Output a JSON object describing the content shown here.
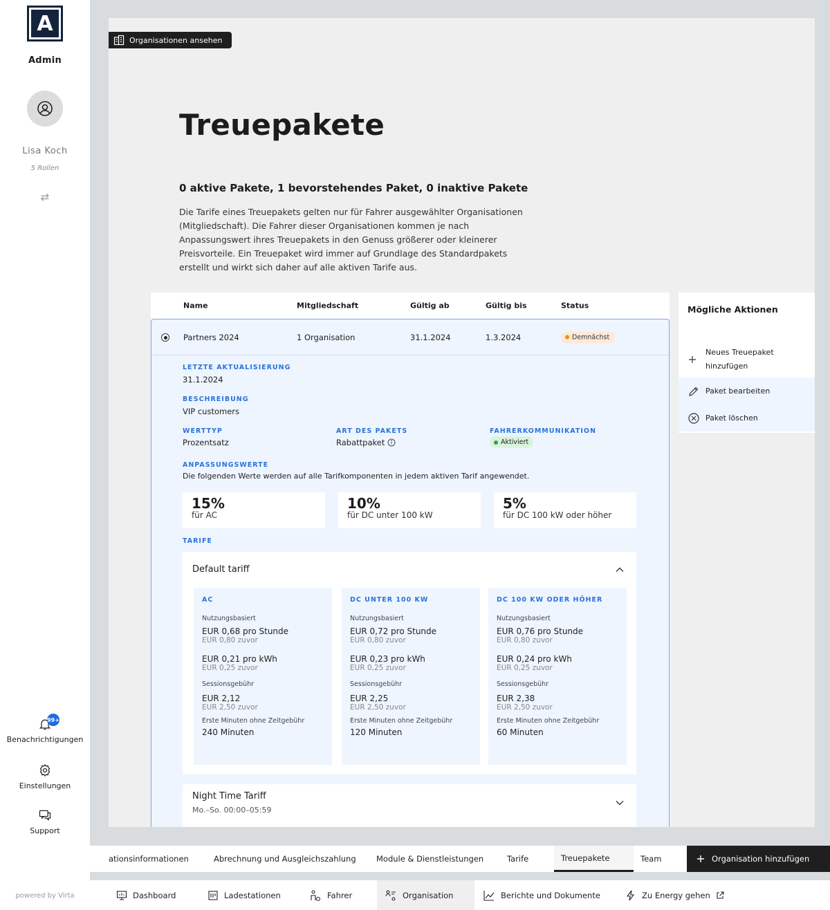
{
  "sidebar": {
    "logo_letter": "A",
    "role": "Admin",
    "user_name": "Lisa Koch",
    "user_roles": "5 Rollen",
    "notifications_badge": "99+",
    "notifications_label": "Benachrichtigungen",
    "settings_label": "Einstellungen",
    "support_label": "Support",
    "powered_by": "powered by Virta"
  },
  "header": {
    "view_orgs_button": "Organisationen ansehen",
    "page_title": "Treuepakete",
    "summary": "0 aktive Pakete, 1 bevorstehendes Paket, 0 inaktive Pakete",
    "description": "Die Tarife eines Treuepakets gelten nur für Fahrer ausgewählter Organisationen (Mitgliedschaft). Die Fahrer dieser Organisationen kommen je nach Anpassungswert ihres Treuepakets in den Genuss größerer oder kleinerer Preisvorteile. Ein Treuepaket wird immer auf Grundlage des Standardpakets erstellt und wirkt sich daher auf alle aktiven Tarife aus."
  },
  "table": {
    "columns": [
      "Name",
      "Mitgliedschaft",
      "Gültig ab",
      "Gültig bis",
      "Status"
    ],
    "row": {
      "name": "Partners 2024",
      "membership": "1 Organisation",
      "valid_from": "31.1.2024",
      "valid_to": "1.3.2024",
      "status": "Demnächst"
    },
    "details": {
      "last_update_label": "LETZTE AKTUALISIERUNG",
      "last_update": "31.1.2024",
      "description_label": "BESCHREIBUNG",
      "description": "VIP customers",
      "value_type_label": "WERTTYP",
      "value_type": "Prozentsatz",
      "package_type_label": "ART DES PAKETS",
      "package_type": "Rabattpaket",
      "driver_comm_label": "FAHRERKOMMUNIKATION",
      "driver_comm": "Aktiviert",
      "adjust_label": "ANPASSUNGSWERTE",
      "adjust_note": "Die folgenden Werte werden auf alle Tarifkomponenten in jedem aktiven Tarif angewendet.",
      "adjustments": [
        {
          "value": "15%",
          "for": "für AC"
        },
        {
          "value": "10%",
          "for": "für DC unter 100 kW"
        },
        {
          "value": "5%",
          "for": "für DC 100 kW oder höher"
        }
      ],
      "tariffs_label": "TARIFE"
    }
  },
  "tariffs": {
    "default": {
      "title": "Default tariff",
      "cards": [
        {
          "heading": "AC",
          "usage_label": "Nutzungsbasiert",
          "hour_price": "EUR 0,68 pro Stunde",
          "hour_prev": "EUR 0,80 zuvor",
          "kwh_price": "EUR 0,21 pro kWh",
          "kwh_prev": "EUR 0,25 zuvor",
          "session_label": "Sessionsgebühr",
          "session_price": "EUR 2,12",
          "session_prev": "EUR 2,50 zuvor",
          "free_label": "Erste Minuten ohne Zeitgebühr",
          "free_minutes": "240 Minuten"
        },
        {
          "heading": "DC UNTER 100 KW",
          "usage_label": "Nutzungsbasiert",
          "hour_price": "EUR 0,72 pro Stunde",
          "hour_prev": "EUR 0,80 zuvor",
          "kwh_price": "EUR 0,23 pro kWh",
          "kwh_prev": "EUR 0,25 zuvor",
          "session_label": "Sessionsgebühr",
          "session_price": "EUR 2,25",
          "session_prev": "EUR 2,50 zuvor",
          "free_label": "Erste Minuten ohne Zeitgebühr",
          "free_minutes": "120 Minuten"
        },
        {
          "heading": "DC 100 KW ODER HÖHER",
          "usage_label": "Nutzungsbasiert",
          "hour_price": "EUR 0,76 pro Stunde",
          "hour_prev": "EUR 0,80 zuvor",
          "kwh_price": "EUR 0,24 pro kWh",
          "kwh_prev": "EUR 0,25 zuvor",
          "session_label": "Sessionsgebühr",
          "session_price": "EUR 2,38",
          "session_prev": "EUR 2,50 zuvor",
          "free_label": "Erste Minuten ohne Zeitgebühr",
          "free_minutes": "60 Minuten"
        }
      ]
    },
    "night": {
      "title": "Night Time Tariff",
      "schedule": "Mo.–So. 00:00–05:59"
    }
  },
  "actions": {
    "title": "Mögliche Aktionen",
    "new_package_line1": "Neues Treuepaket",
    "new_package_line2": "hinzufügen",
    "edit": "Paket bearbeiten",
    "delete": "Paket löschen"
  },
  "tabs": {
    "items": [
      "ationsinformationen",
      "Abrechnung und Ausgleichszahlung",
      "Module & Dienstleistungen",
      "Tarife",
      "Treuepakete",
      "Team"
    ],
    "add_org": "Organisation hinzufügen"
  },
  "nav": {
    "items": [
      "Dashboard",
      "Ladestationen",
      "Fahrer",
      "Organisation",
      "Berichte und Dokumente",
      "Zu Energy gehen"
    ]
  },
  "colors": {
    "accent_blue": "#2a73d9",
    "selected_row_bg": "#eef5ff",
    "status_orange": "#f08a24",
    "status_green": "#2ca44a",
    "dark": "#1f1f1f"
  }
}
